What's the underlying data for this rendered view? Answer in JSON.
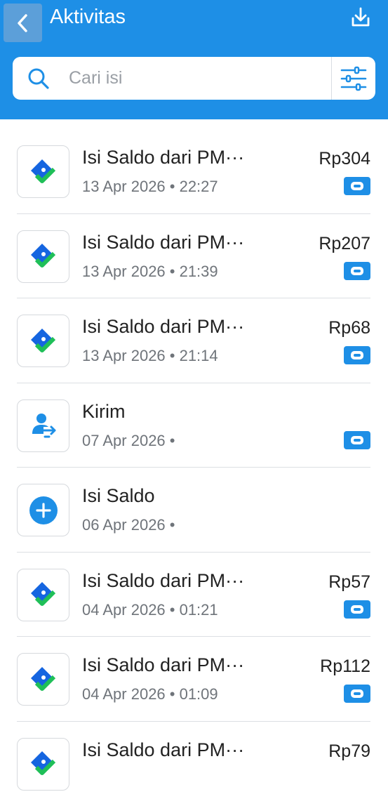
{
  "header": {
    "title": "Aktivitas",
    "back_icon": "chevron-left-icon",
    "download_icon": "download-icon",
    "background_color": "#1e8fe6"
  },
  "search": {
    "placeholder": "Cari isi",
    "value": "",
    "filter_icon": "sliders-icon"
  },
  "transactions": [
    {
      "icon": "wallet-diamond-icon",
      "name": "Isi Saldo dari PM···",
      "date": "13 Apr 2026 • 22:27",
      "amount": "Rp304",
      "badge": "wallet-badge-icon"
    },
    {
      "icon": "wallet-diamond-icon",
      "name": "Isi Saldo dari PM···",
      "date": "13 Apr 2026 • 21:39",
      "amount": "Rp207",
      "badge": "wallet-badge-icon"
    },
    {
      "icon": "wallet-diamond-icon",
      "name": "Isi Saldo dari PM···",
      "date": "13 Apr 2026 • 21:14",
      "amount": "Rp68",
      "badge": "wallet-badge-icon"
    },
    {
      "icon": "person-transfer-icon",
      "name": "Kirim",
      "date": "07 Apr 2026 •",
      "amount": "",
      "badge": "wallet-badge-icon"
    },
    {
      "icon": "plus-circle-icon",
      "name": "Isi Saldo",
      "date": "06 Apr 2026 •",
      "amount": "",
      "badge": ""
    },
    {
      "icon": "wallet-diamond-icon",
      "name": "Isi Saldo dari PM···",
      "date": "04 Apr 2026 • 01:21",
      "amount": "Rp57",
      "badge": "wallet-badge-icon"
    },
    {
      "icon": "wallet-diamond-icon",
      "name": "Isi Saldo dari PM···",
      "date": "04 Apr 2026 • 01:09",
      "amount": "Rp112",
      "badge": "wallet-badge-icon"
    },
    {
      "icon": "wallet-diamond-icon",
      "name": "Isi Saldo dari PM···",
      "date": "",
      "amount": "Rp79",
      "badge": ""
    }
  ]
}
